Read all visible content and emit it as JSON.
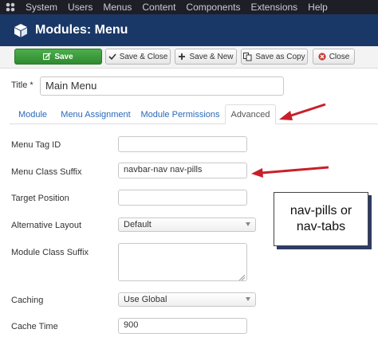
{
  "menubar": {
    "logo": "joomla-logo-icon",
    "items": [
      "System",
      "Users",
      "Menus",
      "Content",
      "Components",
      "Extensions",
      "Help"
    ]
  },
  "header": {
    "icon": "cube-icon",
    "title": "Modules: Menu"
  },
  "toolbar": {
    "save": "Save",
    "save_close": "Save & Close",
    "save_new": "Save & New",
    "save_copy": "Save as Copy",
    "close": "Close"
  },
  "title_field": {
    "label": "Title *",
    "value": "Main Menu"
  },
  "tabs": [
    "Module",
    "Menu Assignment",
    "Module Permissions",
    "Advanced"
  ],
  "active_tab": "Advanced",
  "form": {
    "menu_tag_id": {
      "label": "Menu Tag ID",
      "value": ""
    },
    "menu_class_suffix": {
      "label": "Menu Class Suffix",
      "value": "navbar-nav nav-pills"
    },
    "target_position": {
      "label": "Target Position",
      "value": ""
    },
    "alternative_layout": {
      "label": "Alternative Layout",
      "value": "Default"
    },
    "module_class_suffix": {
      "label": "Module Class Suffix",
      "value": ""
    },
    "caching": {
      "label": "Caching",
      "value": "Use Global"
    },
    "cache_time": {
      "label": "Cache Time",
      "value": "900"
    }
  },
  "callout": {
    "line1": "nav-pills or",
    "line2": "nav-tabs"
  },
  "colors": {
    "menubar_bg": "#1e1f26",
    "header_bg": "#1a3867",
    "save_green": "#3c9c3c",
    "link_blue": "#2a69b8",
    "arrow_red": "#c8202a"
  }
}
